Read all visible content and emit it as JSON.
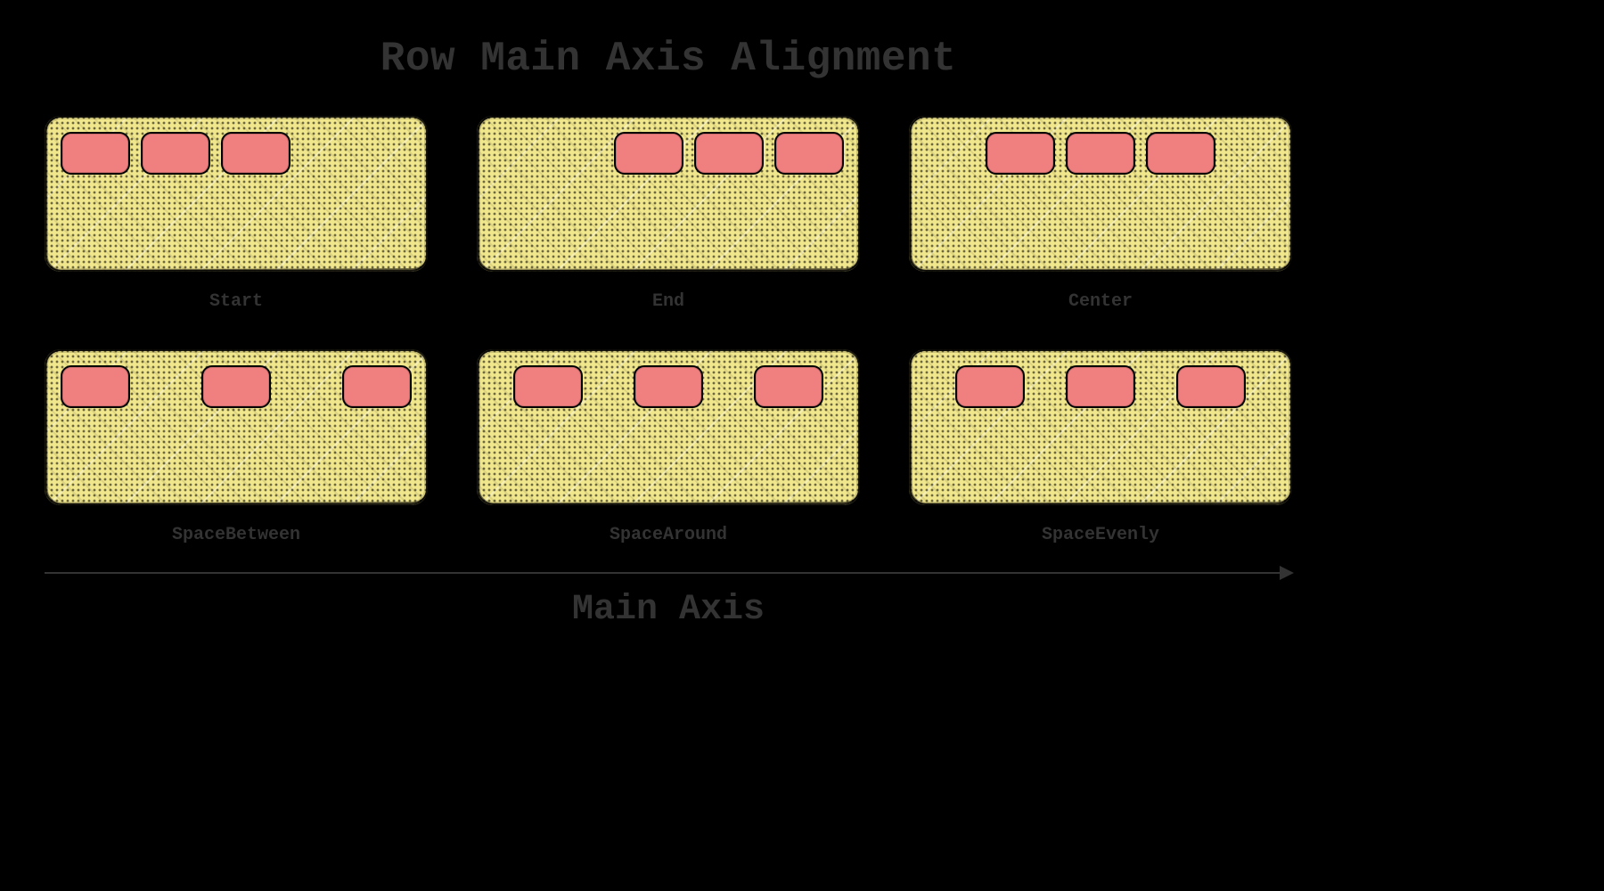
{
  "title": "Row Main Axis Alignment",
  "axis_label": "Main Axis",
  "colors": {
    "background": "#000000",
    "container_fill": "#F0E68C",
    "item_fill": "#F08080",
    "text": "#333333"
  },
  "item_count_per_container": 3,
  "alignments": [
    {
      "key": "start",
      "label": "Start",
      "css": "j-start"
    },
    {
      "key": "end",
      "label": "End",
      "css": "j-end"
    },
    {
      "key": "center",
      "label": "Center",
      "css": "j-center"
    },
    {
      "key": "spacebetween",
      "label": "SpaceBetween",
      "css": "j-spacebetween"
    },
    {
      "key": "spacearound",
      "label": "SpaceAround",
      "css": "j-spacearound"
    },
    {
      "key": "spaceevenly",
      "label": "SpaceEvenly",
      "css": "j-spaceevenly"
    }
  ]
}
